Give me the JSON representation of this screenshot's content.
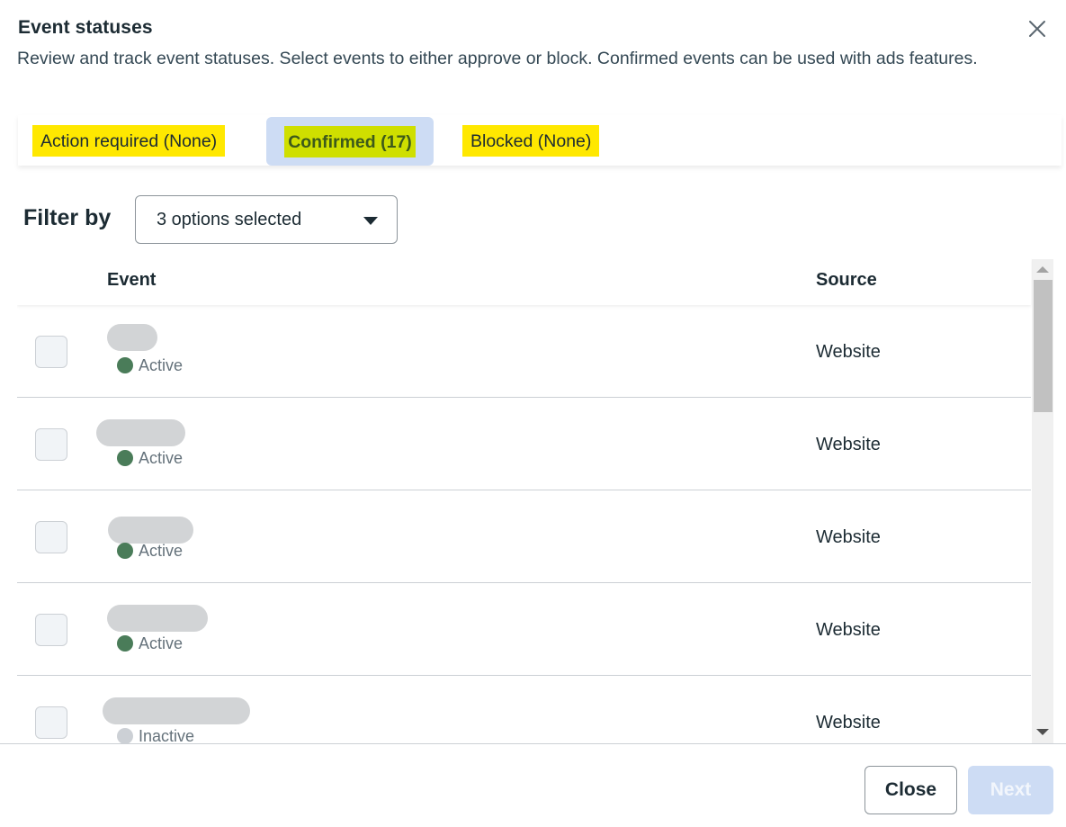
{
  "dialog": {
    "title": "Event statuses",
    "subtitle": "Review and track event statuses. Select events to either approve or block. Confirmed events can be used with ads features.",
    "close_icon": "close-x-icon"
  },
  "tabs": [
    {
      "label": "Action required (None)",
      "selected": false
    },
    {
      "label": "Confirmed (17)",
      "selected": true
    },
    {
      "label": "Blocked (None)",
      "selected": false
    }
  ],
  "filter": {
    "label": "Filter by",
    "value": "3 options selected",
    "icon": "caret-down-icon"
  },
  "table": {
    "columns": [
      "Event",
      "Source"
    ],
    "rows": [
      {
        "event_name": "",
        "status": "Active",
        "status_color": "#4a7c59",
        "source": "Website",
        "checked": false
      },
      {
        "event_name": "",
        "status": "Active",
        "status_color": "#4a7c59",
        "source": "Website",
        "checked": false
      },
      {
        "event_name": "",
        "status": "Active",
        "status_color": "#4a7c59",
        "source": "Website",
        "checked": false
      },
      {
        "event_name": "",
        "status": "Active",
        "status_color": "#4a7c59",
        "source": "Website",
        "checked": false
      },
      {
        "event_name": "",
        "status": "Inactive",
        "status_color": "#ccd0d5",
        "source": "Website",
        "checked": false
      }
    ]
  },
  "footer": {
    "close_label": "Close",
    "next_label": "Next",
    "next_disabled": true
  },
  "colors": {
    "highlight_yellow": "#ffe800",
    "selected_tab_bg": "#cddcf4",
    "active_dot": "#4a7c59",
    "inactive_dot": "#ccd0d5"
  }
}
